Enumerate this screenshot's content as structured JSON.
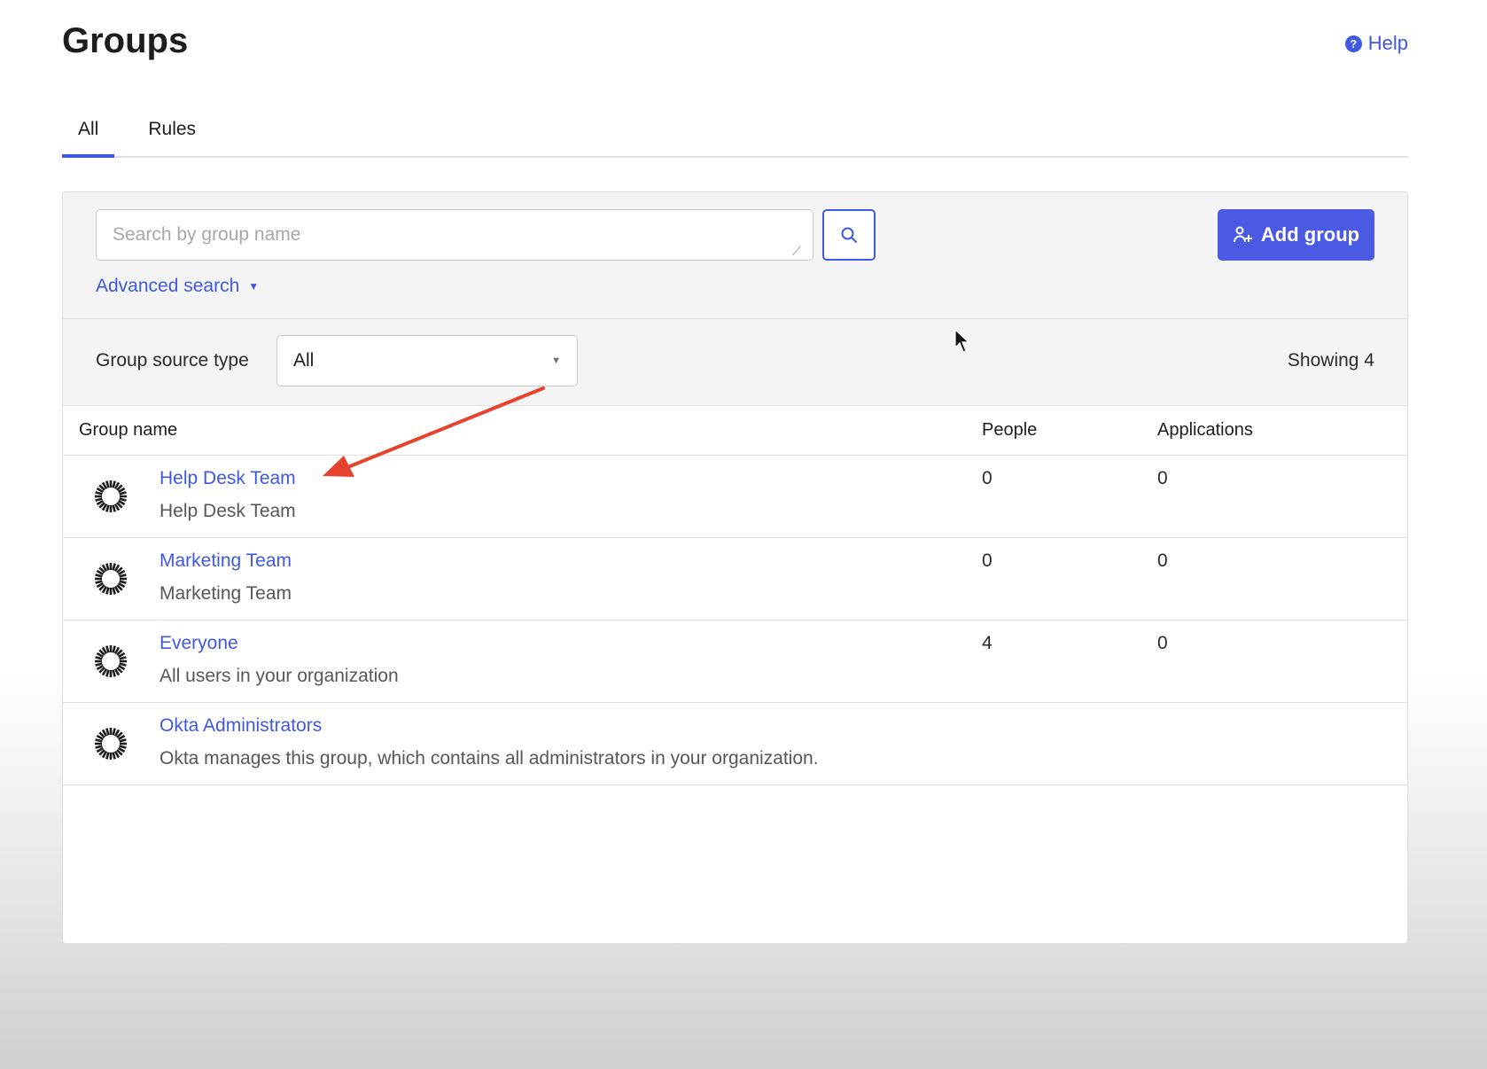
{
  "page": {
    "title": "Groups",
    "help_label": "Help"
  },
  "tabs": [
    {
      "label": "All",
      "active": true
    },
    {
      "label": "Rules",
      "active": false
    }
  ],
  "search": {
    "placeholder": "Search by group name",
    "value": "",
    "advanced_label": "Advanced search"
  },
  "actions": {
    "add_group_label": "Add group"
  },
  "filter": {
    "label": "Group source type",
    "selected": "All",
    "showing_text": "Showing 4"
  },
  "table": {
    "columns": {
      "name": "Group name",
      "people": "People",
      "applications": "Applications"
    },
    "rows": [
      {
        "name": "Help Desk Team",
        "description": "Help Desk Team",
        "people": "0",
        "applications": "0"
      },
      {
        "name": "Marketing Team",
        "description": "Marketing Team",
        "people": "0",
        "applications": "0"
      },
      {
        "name": "Everyone",
        "description": "All users in your organization",
        "people": "4",
        "applications": "0"
      },
      {
        "name": "Okta Administrators",
        "description": "Okta manages this group, which contains all administrators in your organization.",
        "people": "",
        "applications": ""
      }
    ]
  },
  "icons": {
    "help": "help-circle-icon",
    "search": "search-icon",
    "add_group": "add-group-icon",
    "group_row": "okta-group-icon",
    "select": "chevron-down-icon"
  },
  "colors": {
    "accent": "#3f59e4",
    "button": "#4b5ae3",
    "annotation": "#e5432e"
  }
}
